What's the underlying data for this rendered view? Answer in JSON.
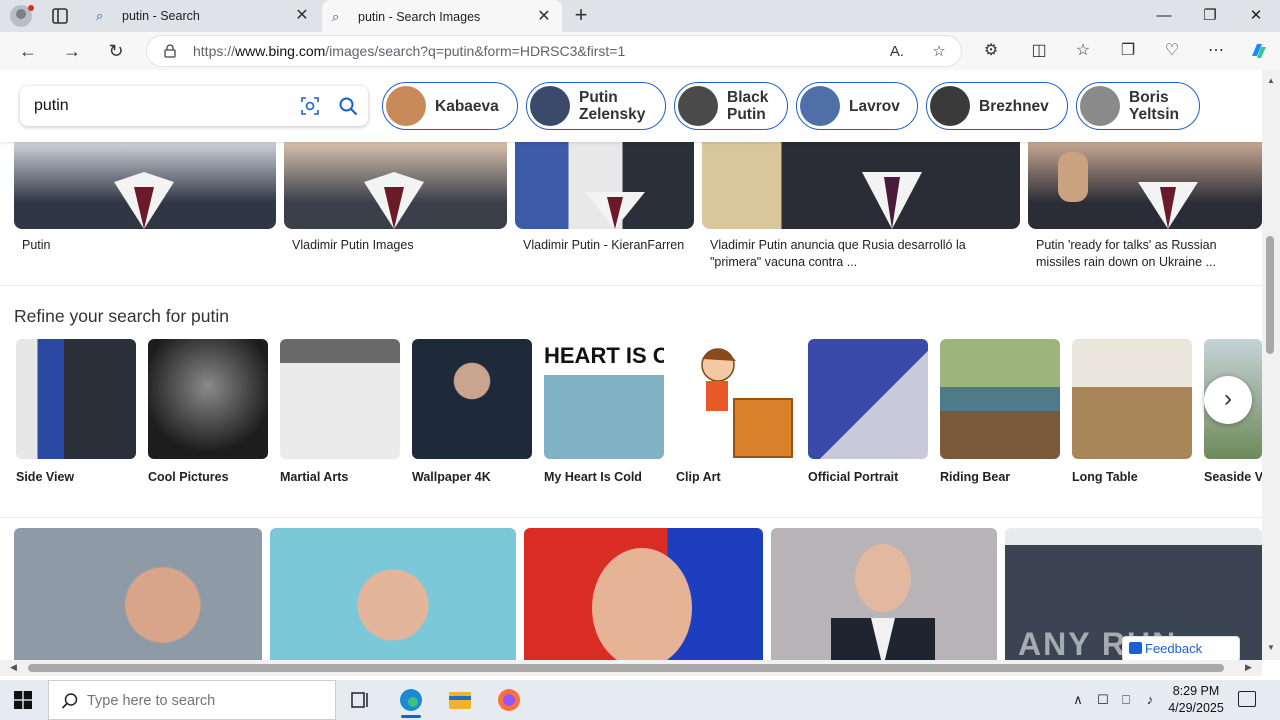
{
  "browser": {
    "tabs": [
      {
        "title": "putin - Search",
        "active": false
      },
      {
        "title": "putin - Search Images",
        "active": true
      }
    ],
    "url_prefix": "https://",
    "url_domain": "www.bing.com",
    "url_path": "/images/search?q=putin&form=HDRSC3&first=1"
  },
  "search": {
    "query": "putin",
    "related_chips": [
      {
        "label": "Kabaeva",
        "avatar_color": "#c98a5a"
      },
      {
        "label": "Putin Zelensky",
        "avatar_color": "#3b4a6b"
      },
      {
        "label": "Black Putin",
        "avatar_color": "#4a4a4a"
      },
      {
        "label": "Lavrov",
        "avatar_color": "#4f6fa8"
      },
      {
        "label": "Brezhnev",
        "avatar_color": "#3a3a3a"
      },
      {
        "label": "Boris Yeltsin",
        "avatar_color": "#8a8a8a"
      }
    ]
  },
  "top_results": [
    {
      "caption": "Putin"
    },
    {
      "caption": "Vladimir Putin Images"
    },
    {
      "caption": "Vladimir Putin - KieranFarren"
    },
    {
      "caption": "Vladimir Putin anuncia que Rusia desarrolló la \"primera\" vacuna contra ..."
    },
    {
      "caption": "Putin 'ready for talks' as Russian missiles rain down on Ukraine ..."
    }
  ],
  "refine": {
    "title": "Refine your search for putin",
    "items": [
      {
        "label": "Side View",
        "color": "#2e3d6b"
      },
      {
        "label": "Cool Pictures",
        "color": "#3c3c3c"
      },
      {
        "label": "Martial Arts",
        "color": "#d9d9d9"
      },
      {
        "label": "Wallpaper 4K",
        "color": "#1e2a3a"
      },
      {
        "label": "My Heart Is Cold",
        "color": "#7fa7b8",
        "tile_text": "HEART IS CO"
      },
      {
        "label": "Clip Art",
        "color": "#f5f5f5"
      },
      {
        "label": "Official Portrait",
        "color": "#3f4e8f"
      },
      {
        "label": "Riding Bear",
        "color": "#6f8a4a"
      },
      {
        "label": "Long Table",
        "color": "#cfc6b4"
      },
      {
        "label": "Seaside V",
        "color": "#8aa0a8"
      }
    ]
  },
  "bottom_results": [
    {
      "color": "#8e9aa6"
    },
    {
      "color": "#7bc8d9"
    },
    {
      "color": "#d92d23"
    },
    {
      "color": "#b7b3b7"
    },
    {
      "color": "#3b4453"
    }
  ],
  "feedback_label": "Feedback",
  "watermark": "ANY RUN",
  "taskbar": {
    "search_placeholder": "Type here to search",
    "time": "8:29 PM",
    "date": "4/29/2025"
  }
}
